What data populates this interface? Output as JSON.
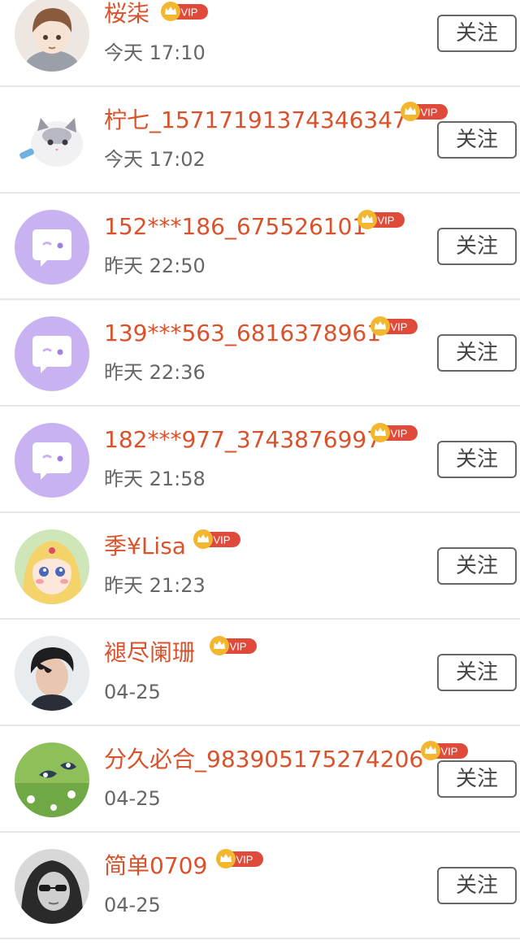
{
  "follow_label": "关注",
  "vip_label": "VIP",
  "colors": {
    "name": "#d9522b",
    "time": "#666666",
    "vip_badge": "#e04a3a",
    "vip_crown": "#f2b72f",
    "default_avatar_bg": "#c9b2f1"
  },
  "users": [
    {
      "name": "桜柒",
      "time": "今天 17:10",
      "avatar": "avatar-cartoon-boy"
    },
    {
      "name": "柠七_15717191374346347",
      "time": "今天 17:02",
      "avatar": "avatar-cat"
    },
    {
      "name": "152***186_675526101",
      "time": "昨天 22:50",
      "avatar": "avatar-default-chat"
    },
    {
      "name": "139***563_6816378961",
      "time": "昨天 22:36",
      "avatar": "avatar-default-chat"
    },
    {
      "name": "182***977_3743876997",
      "time": "昨天 21:58",
      "avatar": "avatar-default-chat"
    },
    {
      "name": "季¥Lisa",
      "time": "昨天 21:23",
      "avatar": "avatar-anime-girl"
    },
    {
      "name": "褪尽阑珊",
      "time": "04-25",
      "avatar": "avatar-photo-man"
    },
    {
      "name": "分久必合_983905175274206",
      "time": "04-25",
      "avatar": "avatar-birds"
    },
    {
      "name": "简单0709",
      "time": "04-25",
      "avatar": "avatar-photo-woman"
    }
  ]
}
